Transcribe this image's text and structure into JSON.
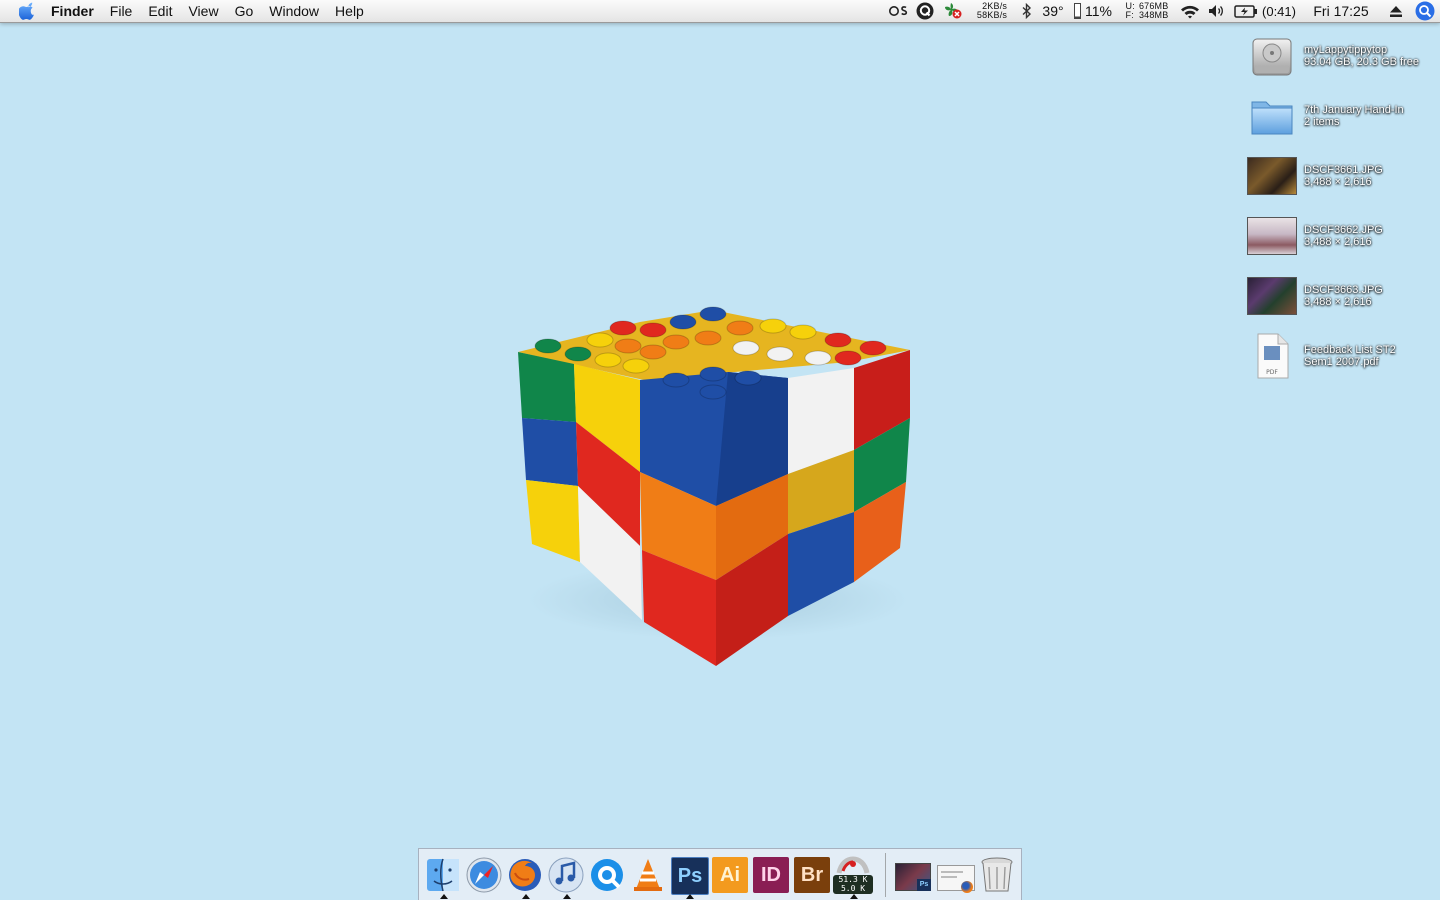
{
  "menubar": {
    "app_name": "Finder",
    "menus": [
      "File",
      "Edit",
      "View",
      "Go",
      "Window",
      "Help"
    ],
    "net_up": "2KB/s",
    "net_down": "58KB/s",
    "temperature": "39°",
    "cpu_percent": "11%",
    "mem_used_label": "U:",
    "mem_used": "676MB",
    "mem_free_label": "F:",
    "mem_free": "348MB",
    "battery_time": "(0:41)",
    "clock": "Fri 17:25"
  },
  "desktop_icons": [
    {
      "name": "myLappytippytop",
      "info": "93.04 GB, 20.3 GB free",
      "icon": "hard-drive-icon"
    },
    {
      "name": "7th January Hand-In",
      "info": "2 items",
      "icon": "folder-icon"
    },
    {
      "name": "DSCF3661.JPG",
      "info": "3,488 × 2,616",
      "icon": "photo-thumbnail"
    },
    {
      "name": "DSCF3662.JPG",
      "info": "3,488 × 2,616",
      "icon": "photo-thumbnail"
    },
    {
      "name": "DSCF3663.JPG",
      "info": "3,488 × 2,616",
      "icon": "photo-thumbnail"
    },
    {
      "name": "Feedback List ST2",
      "name2": "Sem1 2007.pdf",
      "icon": "pdf-icon"
    }
  ],
  "dock": {
    "apps": [
      "Finder",
      "Safari",
      "Firefox",
      "iTunes",
      "QuickTime",
      "VLC",
      "Photoshop",
      "Illustrator",
      "InDesign",
      "Bridge",
      "Network Monitor",
      "Photos Stack",
      "Downloads Stack",
      "Trash"
    ],
    "adobe_labels": {
      "ps": "Ps",
      "ai": "Ai",
      "id": "ID",
      "br": "Br"
    },
    "net_monitor_up": "51.3 K",
    "net_monitor_down": "5.0 K",
    "stack_badge": "Ps"
  },
  "colors": {
    "desktop": "#c3e4f4",
    "lego_red": "#e0281f",
    "lego_blue": "#1f4ea6",
    "lego_yellow": "#f6d10b",
    "lego_green": "#10864a",
    "lego_orange": "#f07d16",
    "lego_white": "#f2f2f2"
  }
}
